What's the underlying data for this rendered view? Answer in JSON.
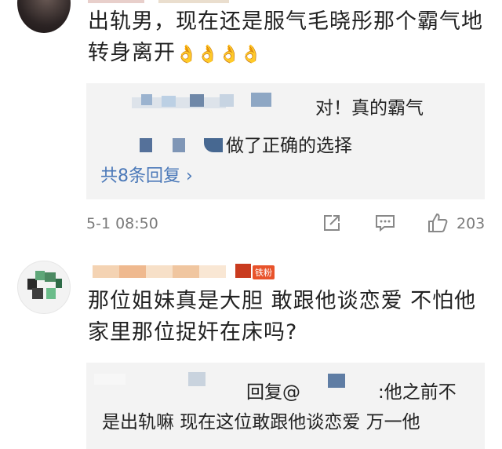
{
  "comment1": {
    "text": "出轨男，现在还是服气毛晓彤那个霸气地转身离开",
    "emojis": "👌👌👌👌",
    "reply1_text": "对！真的霸气",
    "reply2_text": "做了正确的选择",
    "more_replies": "共8条回复 ›",
    "timestamp": "5-1 08:50",
    "like_count": "203"
  },
  "comment2": {
    "badge": "铁粉",
    "text": "那位姐妹真是大胆 敢跟他谈恋爱 不怕他家里那位捉奸在床吗?",
    "reply_prefix": "回复@",
    "reply_text_part1": ":他之前不",
    "reply_text_line2": "是出轨嘛 现在这位敢跟他谈恋爱 万一他"
  },
  "icons": {
    "share": "share-icon",
    "comment": "comment-icon",
    "like": "thumbs-up-icon"
  },
  "colors": {
    "link": "#4a78b8",
    "reply_bg": "#f3f3f3",
    "badge": "#e8532b"
  }
}
